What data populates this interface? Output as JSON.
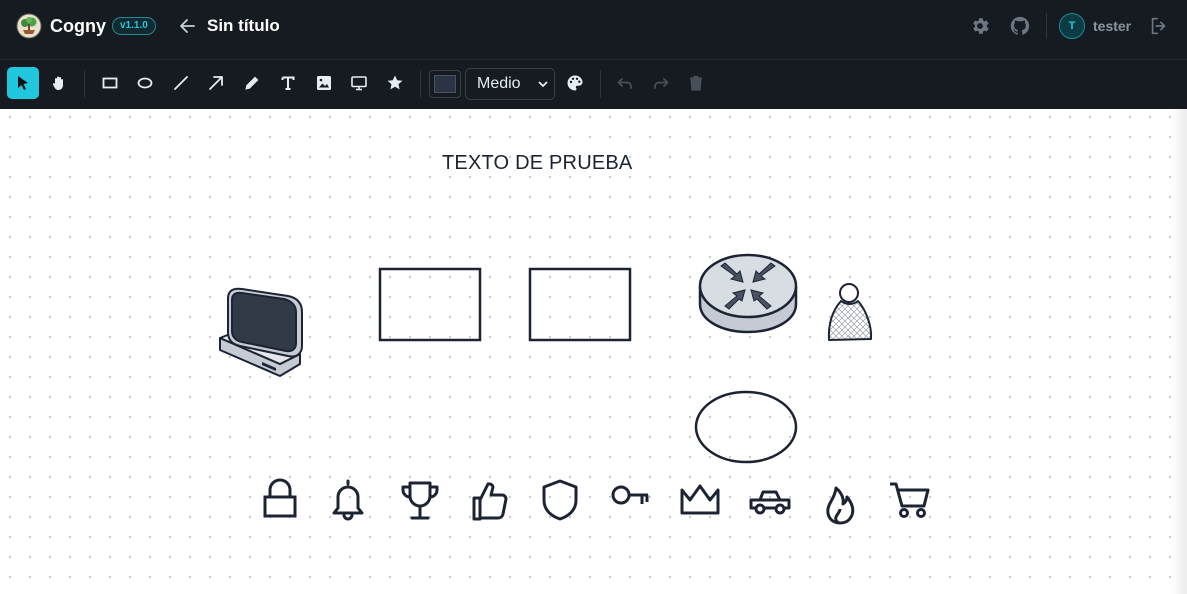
{
  "app": {
    "brand": "Cogny",
    "version": "v1.1.0",
    "document_title": "Sin título"
  },
  "header": {
    "user_initial": "T",
    "username": "tester",
    "icons": [
      "settings-icon",
      "github-icon",
      "logout-icon"
    ]
  },
  "toolbar": {
    "tools": [
      "select",
      "hand",
      "rectangle",
      "ellipse",
      "line",
      "arrow",
      "pencil",
      "text",
      "image",
      "presentation",
      "star"
    ],
    "active_tool": "select",
    "stroke_size": "Medio",
    "stroke_color": "#2b3445",
    "accent": "#21c7dc"
  },
  "canvas": {
    "text_element": "TEXTO DE PRUEBA",
    "shapes": [
      "monitor",
      "rectangle",
      "rectangle",
      "router",
      "person",
      "ellipse"
    ],
    "icon_row": [
      "lock-icon",
      "bell-icon",
      "trophy-icon",
      "thumbs-up-icon",
      "shield-icon",
      "key-icon",
      "crown-icon",
      "car-icon",
      "flame-icon",
      "cart-icon"
    ]
  }
}
